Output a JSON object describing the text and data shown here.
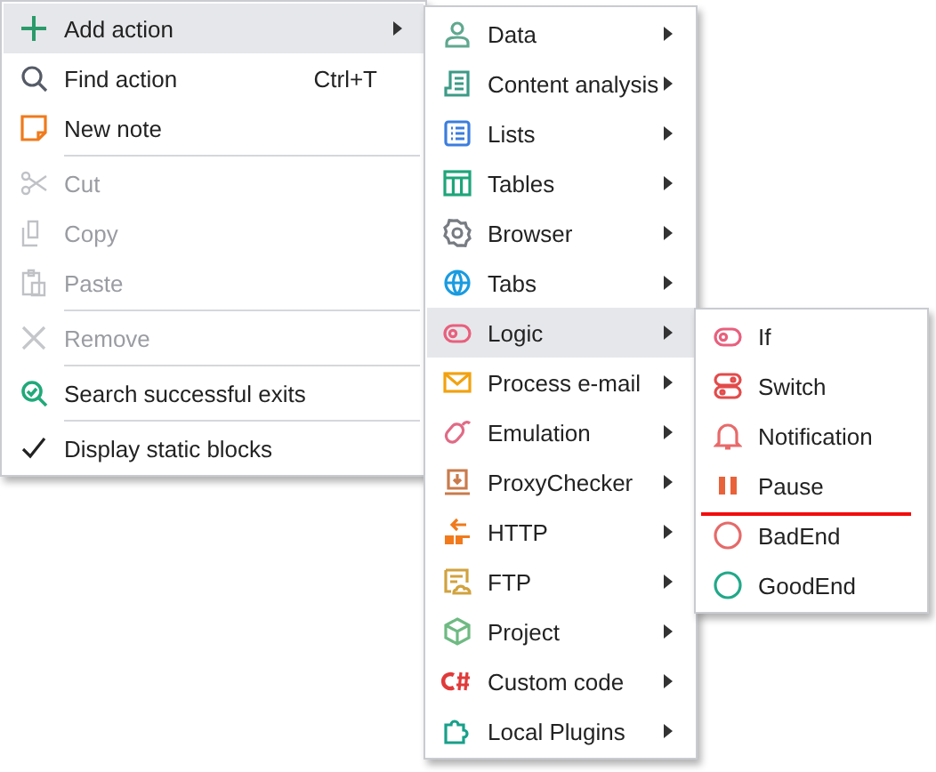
{
  "main_menu": [
    {
      "kind": "item",
      "label": "Add action",
      "selected": true,
      "disabled": false,
      "submenu": true
    },
    {
      "kind": "item",
      "label": "Find action",
      "shortcut": "Ctrl+T",
      "selected": false,
      "disabled": false,
      "submenu": false
    },
    {
      "kind": "item",
      "label": "New note",
      "selected": false,
      "disabled": false,
      "submenu": false
    },
    {
      "kind": "separator"
    },
    {
      "kind": "item",
      "label": "Cut",
      "selected": false,
      "disabled": true,
      "submenu": false
    },
    {
      "kind": "item",
      "label": "Copy",
      "selected": false,
      "disabled": true,
      "submenu": false
    },
    {
      "kind": "item",
      "label": "Paste",
      "selected": false,
      "disabled": true,
      "submenu": false
    },
    {
      "kind": "separator"
    },
    {
      "kind": "item",
      "label": "Remove",
      "selected": false,
      "disabled": true,
      "submenu": false
    },
    {
      "kind": "separator"
    },
    {
      "kind": "item",
      "label": "Search successful exits",
      "selected": false,
      "disabled": false,
      "submenu": false
    },
    {
      "kind": "separator"
    },
    {
      "kind": "check",
      "label": "Display static blocks",
      "checked": true,
      "selected": false,
      "disabled": false,
      "submenu": false
    }
  ],
  "action_menu": [
    {
      "label": "Data",
      "selected": false,
      "submenu": true
    },
    {
      "label": "Content analysis",
      "selected": false,
      "submenu": true
    },
    {
      "label": "Lists",
      "selected": false,
      "submenu": true
    },
    {
      "label": "Tables",
      "selected": false,
      "submenu": true
    },
    {
      "label": "Browser",
      "selected": false,
      "submenu": true
    },
    {
      "label": "Tabs",
      "selected": false,
      "submenu": true
    },
    {
      "label": "Logic",
      "selected": true,
      "submenu": true
    },
    {
      "label": "Process e-mail",
      "selected": false,
      "submenu": true
    },
    {
      "label": "Emulation",
      "selected": false,
      "submenu": true
    },
    {
      "label": "ProxyChecker",
      "selected": false,
      "submenu": true
    },
    {
      "label": "HTTP",
      "selected": false,
      "submenu": true
    },
    {
      "label": "FTP",
      "selected": false,
      "submenu": true
    },
    {
      "label": "Project",
      "selected": false,
      "submenu": true
    },
    {
      "label": "Custom code",
      "selected": false,
      "submenu": true
    },
    {
      "label": "Local Plugins",
      "selected": false,
      "submenu": true
    }
  ],
  "logic_menu": [
    {
      "label": "If"
    },
    {
      "label": "Switch"
    },
    {
      "label": "Notification"
    },
    {
      "label": "Pause",
      "underlined": true
    },
    {
      "label": "BadEnd"
    },
    {
      "label": "GoodEnd"
    }
  ]
}
